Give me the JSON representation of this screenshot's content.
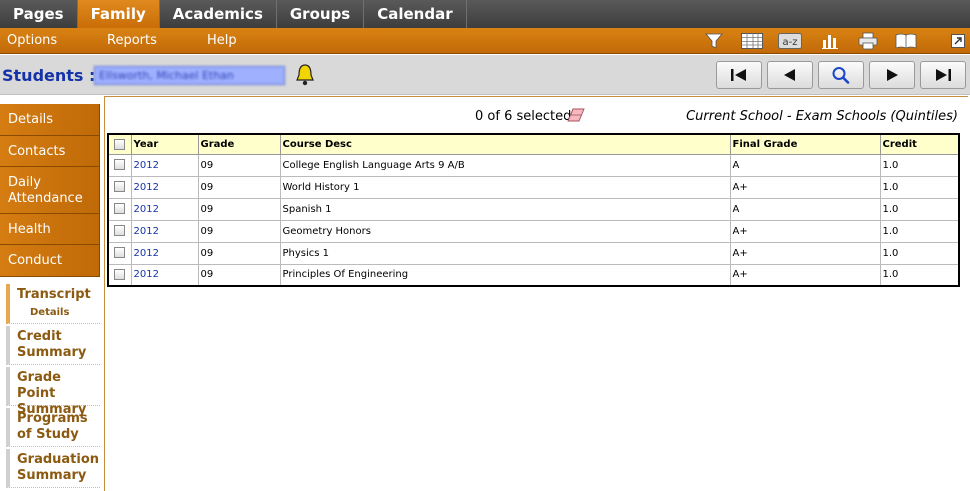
{
  "topnav": {
    "items": [
      "Pages",
      "Family",
      "Academics",
      "Groups",
      "Calendar"
    ],
    "active_index": 1
  },
  "submenu": {
    "items": [
      "Options",
      "Reports",
      "Help"
    ],
    "tools": [
      "filter-icon",
      "grid-icon",
      "sort-az-icon",
      "chart-icon",
      "print-icon",
      "book-icon",
      "popout-icon"
    ],
    "tool_az_label": "a-z"
  },
  "header": {
    "students_label": "Students ::",
    "student_name": "Ellsworth, Michael Ethan"
  },
  "sidemenu": {
    "tabs": [
      "Details",
      "Contacts",
      "Daily Attendance",
      "Health",
      "Conduct"
    ],
    "subs": [
      {
        "label": "Transcript",
        "child": "Details"
      },
      {
        "label": "Credit Summary"
      },
      {
        "label": "Grade Point Summary"
      },
      {
        "label": "Programs of Study"
      },
      {
        "label": "Graduation Summary"
      }
    ]
  },
  "main": {
    "selected_count": "0 of 6 selected",
    "school_context": "Current School - Exam Schools (Quintiles)",
    "columns": [
      "Year",
      "Grade",
      "Course Desc",
      "Final Grade",
      "Credit"
    ],
    "rows": [
      [
        "2012",
        "09",
        "College English Language Arts 9 A/B",
        "A",
        "1.0"
      ],
      [
        "2012",
        "09",
        "World History 1",
        "A+",
        "1.0"
      ],
      [
        "2012",
        "09",
        "Spanish 1",
        "A",
        "1.0"
      ],
      [
        "2012",
        "09",
        "Geometry Honors",
        "A+",
        "1.0"
      ],
      [
        "2012",
        "09",
        "Physics 1",
        "A+",
        "1.0"
      ],
      [
        "2012",
        "09",
        "Principles Of Engineering",
        "A+",
        "1.0"
      ]
    ]
  },
  "colors": {
    "accent": "#c96d08",
    "link": "#1533a8",
    "header_row": "#ffffcc"
  }
}
